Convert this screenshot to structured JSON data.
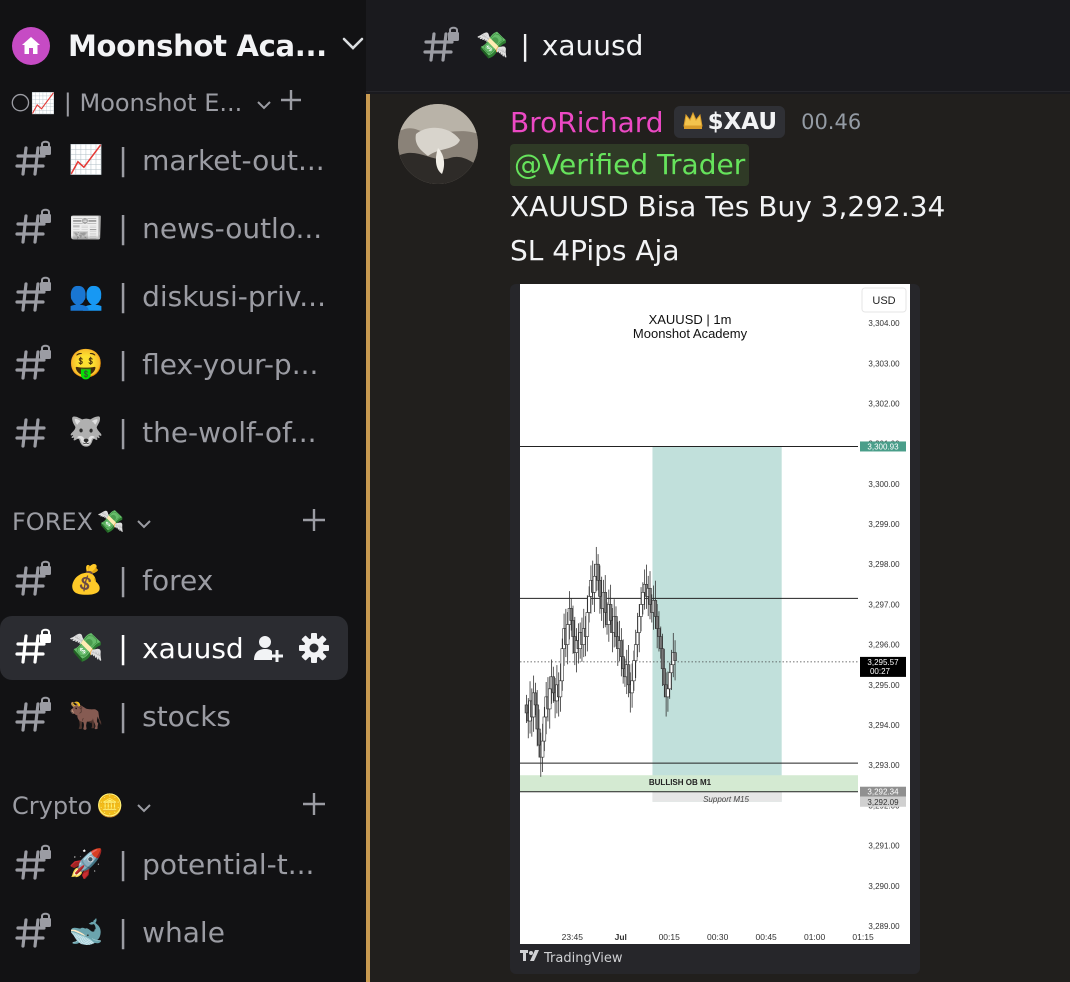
{
  "server": {
    "name": "Moonshot Aca...",
    "icon": "house-icon"
  },
  "top_category": {
    "emojis": "🌕📈",
    "label": "| Moonshot E..."
  },
  "channels_top": [
    {
      "emoji": "📈",
      "name": "market-out...",
      "locked": true
    },
    {
      "emoji": "📰",
      "name": "news-outlo...",
      "locked": true
    },
    {
      "emoji": "👥",
      "name": "diskusi-priv...",
      "locked": true
    },
    {
      "emoji": "🤑",
      "name": "flex-your-p...",
      "locked": true
    },
    {
      "emoji": "🐺",
      "name": "the-wolf-of...",
      "locked": false
    }
  ],
  "forex_category": {
    "label": "FOREX",
    "emoji": "💸"
  },
  "forex_channels": [
    {
      "emoji": "💰",
      "name": "forex"
    },
    {
      "emoji": "💸",
      "name": "xauusd",
      "active": true
    },
    {
      "emoji": "🐂",
      "name": "stocks"
    }
  ],
  "crypto_category": {
    "label": "Crypto",
    "emoji": "🪙"
  },
  "crypto_channels": [
    {
      "emoji": "🚀",
      "name": "potential-t..."
    },
    {
      "emoji": "🐋",
      "name": "whale"
    }
  ],
  "separator": "|",
  "topbar": {
    "emoji": "💸",
    "sep": "|",
    "channel": "xauusd"
  },
  "message": {
    "username": "BroRichard",
    "role_tag": "$XAU",
    "time": "00.46",
    "mention": "@Verified Trader",
    "line1": "XAUUSD Bisa Tes Buy 3,292.34",
    "line2": "SL 4Pips Aja"
  },
  "colors": {
    "username": "#ec49c4",
    "mention": "#66e35c",
    "highlight": "#c89a51",
    "tp_zone": "#c1e0db",
    "ob_zone": "#d4ead2"
  },
  "chart_data": {
    "type": "candlestick",
    "title": "XAUUSD | 1m",
    "subtitle": "Moonshot Academy",
    "currency": "USD",
    "ylim": [
      3288.8,
      3304.4
    ],
    "y_ticks": [
      "3,304.00",
      "3,303.00",
      "3,302.00",
      "3,301.00",
      "3,300.00",
      "3,299.00",
      "3,298.00",
      "3,297.00",
      "3,296.00",
      "3,295.00",
      "3,294.00",
      "3,293.00",
      "3,292.00",
      "3,291.00",
      "3,290.00",
      "3,289.00"
    ],
    "x_ticks": [
      "23:45",
      "Jul",
      "00:15",
      "00:30",
      "00:45",
      "01:00",
      "01:15"
    ],
    "horizontal_lines": [
      3300.93,
      3297.15,
      3293.05,
      3292.34
    ],
    "last_price": 3295.57,
    "countdown": "00:27",
    "price_labels": [
      {
        "value": 3300.93,
        "text": "3,300.93",
        "color": "#4a9e8a"
      },
      {
        "value": 3295.57,
        "text": "3,295.57",
        "color": "#000000"
      },
      {
        "value": 3292.34,
        "text": "3,292.34",
        "color": "#909090"
      },
      {
        "value": 3292.09,
        "text": "3,292.09",
        "color": "#d0d0d0"
      }
    ],
    "zones": [
      {
        "label": "",
        "y_top": 3300.93,
        "y_bottom": 3292.09,
        "x_start": "00:16",
        "x_end": "00:56",
        "color": "#c1e0db"
      },
      {
        "label": "BULLISH OB M1",
        "y_top": 3292.75,
        "y_bottom": 3292.34,
        "color": "#d4ead2"
      },
      {
        "label": "Support M15",
        "y_top": 3292.34,
        "y_bottom": 3292.09,
        "color": "#e6e6e6"
      }
    ],
    "close_series": [
      3294.3,
      3294.1,
      3294.6,
      3294.2,
      3294.8,
      3294.5,
      3293.9,
      3293.5,
      3293.2,
      3293.6,
      3294.2,
      3294.7,
      3294.4,
      3294.9,
      3295.2,
      3294.8,
      3294.6,
      3295.0,
      3294.7,
      3295.1,
      3295.9,
      3296.4,
      3296.0,
      3296.5,
      3296.9,
      3296.6,
      3296.2,
      3295.8,
      3296.1,
      3295.9,
      3296.3,
      3296.0,
      3296.4,
      3296.2,
      3296.8,
      3297.2,
      3297.6,
      3297.3,
      3297.7,
      3298.0,
      3297.6,
      3297.2,
      3296.9,
      3297.3,
      3296.8,
      3296.5,
      3297.0,
      3296.6,
      3296.3,
      3296.7,
      3296.2,
      3295.9,
      3296.1,
      3295.7,
      3295.4,
      3295.2,
      3295.5,
      3295.0,
      3294.8,
      3295.1,
      3295.6,
      3296.0,
      3296.3,
      3296.7,
      3297.0,
      3297.3,
      3297.5,
      3297.2,
      3297.4,
      3297.0,
      3296.8,
      3297.1,
      3296.7,
      3296.4,
      3296.2,
      3295.9,
      3295.4,
      3295.0,
      3294.7,
      3294.9,
      3295.3,
      3295.5,
      3295.8,
      3295.6
    ]
  }
}
